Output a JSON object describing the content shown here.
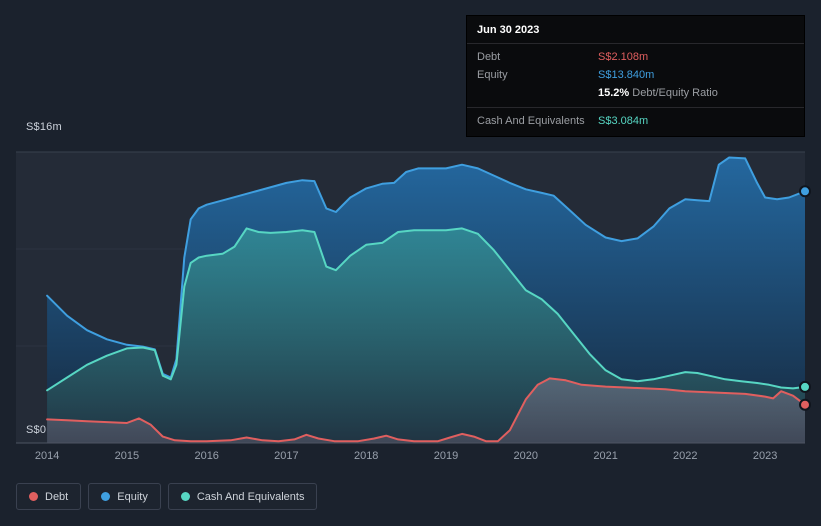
{
  "tooltip": {
    "date": "Jun 30 2023",
    "debt_label": "Debt",
    "debt_value": "S$2.108m",
    "equity_label": "Equity",
    "equity_value": "S$13.840m",
    "ratio_value": "15.2%",
    "ratio_label": "Debt/Equity Ratio",
    "cash_label": "Cash And Equivalents",
    "cash_value": "S$3.084m"
  },
  "axis": {
    "y_top": "S$16m",
    "y_bottom": "S$0"
  },
  "legend": {
    "items": [
      {
        "id": "debt",
        "label": "Debt",
        "color": "#e05f5f"
      },
      {
        "id": "equity",
        "label": "Equity",
        "color": "#3f9fe0"
      },
      {
        "id": "cash",
        "label": "Cash And Equivalents",
        "color": "#57d6c3"
      }
    ]
  },
  "colors": {
    "background": "#1b222d",
    "plot_bg": "#242b37",
    "grid_major": "#39414e",
    "grid_minor": "#2b3340",
    "axis_line": "#4d5462",
    "axis_text": "#98a0ac",
    "debt": "#e05f5f",
    "equity": "#3f9fe0",
    "cash": "#57d6c3"
  },
  "chart_data": {
    "type": "area",
    "unit": "S$m",
    "xlim": [
      2013.61,
      2023.5
    ],
    "ylim": [
      0,
      16
    ],
    "gridlines": [
      16,
      10.667,
      5.333
    ],
    "x_ticks": [
      2014,
      2015,
      2016,
      2017,
      2018,
      2019,
      2020,
      2021,
      2022,
      2023
    ],
    "series": [
      {
        "id": "equity",
        "name": "Equity",
        "color": "#3f9fe0",
        "fill_top": "rgba(36,110,170,0.9)",
        "fill_bottom": "rgba(20,40,62,0.9)",
        "points": [
          [
            2014.0,
            8.1
          ],
          [
            2014.25,
            7.0
          ],
          [
            2014.5,
            6.2
          ],
          [
            2014.75,
            5.7
          ],
          [
            2015.0,
            5.4
          ],
          [
            2015.2,
            5.3
          ],
          [
            2015.35,
            5.15
          ],
          [
            2015.45,
            3.8
          ],
          [
            2015.55,
            3.6
          ],
          [
            2015.62,
            4.6
          ],
          [
            2015.72,
            10.2
          ],
          [
            2015.8,
            12.3
          ],
          [
            2015.9,
            12.9
          ],
          [
            2016.0,
            13.1
          ],
          [
            2016.25,
            13.4
          ],
          [
            2016.5,
            13.7
          ],
          [
            2016.75,
            14.0
          ],
          [
            2017.0,
            14.3
          ],
          [
            2017.2,
            14.45
          ],
          [
            2017.35,
            14.4
          ],
          [
            2017.5,
            12.9
          ],
          [
            2017.62,
            12.7
          ],
          [
            2017.8,
            13.5
          ],
          [
            2018.0,
            14.0
          ],
          [
            2018.2,
            14.25
          ],
          [
            2018.35,
            14.3
          ],
          [
            2018.5,
            14.9
          ],
          [
            2018.65,
            15.1
          ],
          [
            2018.85,
            15.1
          ],
          [
            2019.0,
            15.1
          ],
          [
            2019.2,
            15.3
          ],
          [
            2019.4,
            15.1
          ],
          [
            2019.6,
            14.7
          ],
          [
            2019.8,
            14.3
          ],
          [
            2020.0,
            13.95
          ],
          [
            2020.2,
            13.75
          ],
          [
            2020.35,
            13.6
          ],
          [
            2020.55,
            12.8
          ],
          [
            2020.75,
            12.0
          ],
          [
            2021.0,
            11.3
          ],
          [
            2021.2,
            11.1
          ],
          [
            2021.4,
            11.25
          ],
          [
            2021.6,
            11.9
          ],
          [
            2021.8,
            12.9
          ],
          [
            2022.0,
            13.4
          ],
          [
            2022.15,
            13.35
          ],
          [
            2022.3,
            13.3
          ],
          [
            2022.42,
            15.3
          ],
          [
            2022.55,
            15.7
          ],
          [
            2022.75,
            15.65
          ],
          [
            2022.9,
            14.3
          ],
          [
            2023.0,
            13.5
          ],
          [
            2023.15,
            13.4
          ],
          [
            2023.3,
            13.5
          ],
          [
            2023.5,
            13.84
          ]
        ]
      },
      {
        "id": "cash",
        "name": "Cash And Equivalents",
        "color": "#57d6c3",
        "fill_top": "rgba(60,170,160,0.55)",
        "fill_bottom": "rgba(35,55,68,0.8)",
        "points": [
          [
            2014.0,
            2.9
          ],
          [
            2014.25,
            3.6
          ],
          [
            2014.5,
            4.3
          ],
          [
            2014.75,
            4.8
          ],
          [
            2015.0,
            5.2
          ],
          [
            2015.2,
            5.25
          ],
          [
            2015.35,
            5.1
          ],
          [
            2015.45,
            3.7
          ],
          [
            2015.55,
            3.5
          ],
          [
            2015.62,
            4.3
          ],
          [
            2015.72,
            8.6
          ],
          [
            2015.8,
            9.9
          ],
          [
            2015.9,
            10.2
          ],
          [
            2016.0,
            10.3
          ],
          [
            2016.2,
            10.4
          ],
          [
            2016.35,
            10.8
          ],
          [
            2016.5,
            11.8
          ],
          [
            2016.65,
            11.6
          ],
          [
            2016.8,
            11.55
          ],
          [
            2017.0,
            11.6
          ],
          [
            2017.2,
            11.7
          ],
          [
            2017.35,
            11.6
          ],
          [
            2017.5,
            9.7
          ],
          [
            2017.62,
            9.5
          ],
          [
            2017.8,
            10.3
          ],
          [
            2018.0,
            10.9
          ],
          [
            2018.2,
            11.0
          ],
          [
            2018.4,
            11.6
          ],
          [
            2018.6,
            11.7
          ],
          [
            2018.8,
            11.7
          ],
          [
            2019.0,
            11.7
          ],
          [
            2019.2,
            11.8
          ],
          [
            2019.4,
            11.5
          ],
          [
            2019.6,
            10.6
          ],
          [
            2019.8,
            9.5
          ],
          [
            2020.0,
            8.4
          ],
          [
            2020.2,
            7.9
          ],
          [
            2020.4,
            7.1
          ],
          [
            2020.6,
            6.0
          ],
          [
            2020.8,
            4.9
          ],
          [
            2021.0,
            4.0
          ],
          [
            2021.2,
            3.5
          ],
          [
            2021.4,
            3.4
          ],
          [
            2021.6,
            3.5
          ],
          [
            2021.8,
            3.7
          ],
          [
            2022.0,
            3.9
          ],
          [
            2022.15,
            3.85
          ],
          [
            2022.3,
            3.7
          ],
          [
            2022.5,
            3.5
          ],
          [
            2022.7,
            3.4
          ],
          [
            2022.9,
            3.3
          ],
          [
            2023.05,
            3.2
          ],
          [
            2023.2,
            3.05
          ],
          [
            2023.35,
            3.0
          ],
          [
            2023.5,
            3.084
          ]
        ]
      },
      {
        "id": "debt",
        "name": "Debt",
        "color": "#e05f5f",
        "fill_top": "rgba(130,125,145,0.5)",
        "fill_bottom": "rgba(90,88,105,0.55)",
        "points": [
          [
            2014.0,
            1.3
          ],
          [
            2014.25,
            1.25
          ],
          [
            2014.5,
            1.2
          ],
          [
            2014.75,
            1.15
          ],
          [
            2015.0,
            1.1
          ],
          [
            2015.15,
            1.35
          ],
          [
            2015.3,
            1.0
          ],
          [
            2015.45,
            0.35
          ],
          [
            2015.6,
            0.15
          ],
          [
            2015.8,
            0.1
          ],
          [
            2016.0,
            0.1
          ],
          [
            2016.3,
            0.15
          ],
          [
            2016.5,
            0.3
          ],
          [
            2016.7,
            0.15
          ],
          [
            2016.9,
            0.1
          ],
          [
            2017.1,
            0.2
          ],
          [
            2017.25,
            0.45
          ],
          [
            2017.4,
            0.25
          ],
          [
            2017.6,
            0.1
          ],
          [
            2017.9,
            0.1
          ],
          [
            2018.1,
            0.25
          ],
          [
            2018.25,
            0.4
          ],
          [
            2018.4,
            0.2
          ],
          [
            2018.6,
            0.1
          ],
          [
            2018.9,
            0.1
          ],
          [
            2019.05,
            0.3
          ],
          [
            2019.2,
            0.5
          ],
          [
            2019.35,
            0.35
          ],
          [
            2019.5,
            0.1
          ],
          [
            2019.65,
            0.1
          ],
          [
            2019.8,
            0.7
          ],
          [
            2020.0,
            2.4
          ],
          [
            2020.15,
            3.2
          ],
          [
            2020.3,
            3.55
          ],
          [
            2020.5,
            3.45
          ],
          [
            2020.7,
            3.2
          ],
          [
            2021.0,
            3.1
          ],
          [
            2021.25,
            3.05
          ],
          [
            2021.5,
            3.0
          ],
          [
            2021.75,
            2.95
          ],
          [
            2022.0,
            2.85
          ],
          [
            2022.25,
            2.8
          ],
          [
            2022.5,
            2.75
          ],
          [
            2022.75,
            2.7
          ],
          [
            2023.0,
            2.55
          ],
          [
            2023.1,
            2.45
          ],
          [
            2023.2,
            2.85
          ],
          [
            2023.35,
            2.6
          ],
          [
            2023.5,
            2.108
          ]
        ]
      }
    ]
  }
}
